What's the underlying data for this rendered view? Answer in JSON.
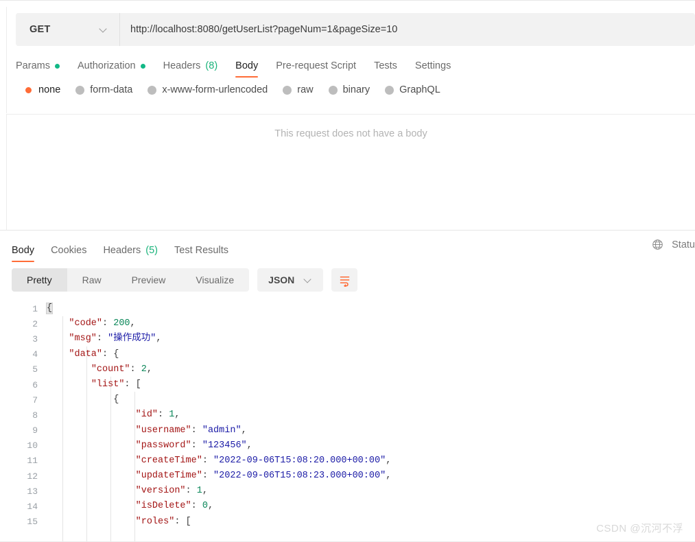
{
  "request": {
    "method": "GET",
    "url": "http://localhost:8080/getUserList?pageNum=1&pageSize=10",
    "tabs": [
      {
        "label": "Params",
        "marker": "dot",
        "active": false
      },
      {
        "label": "Authorization",
        "marker": "dot",
        "active": false
      },
      {
        "label": "Headers",
        "count": "(8)",
        "active": false
      },
      {
        "label": "Body",
        "active": true
      },
      {
        "label": "Pre-request Script",
        "active": false
      },
      {
        "label": "Tests",
        "active": false
      },
      {
        "label": "Settings",
        "active": false
      }
    ],
    "body_types": [
      {
        "label": "none",
        "selected": true
      },
      {
        "label": "form-data",
        "selected": false
      },
      {
        "label": "x-www-form-urlencoded",
        "selected": false
      },
      {
        "label": "raw",
        "selected": false
      },
      {
        "label": "binary",
        "selected": false
      },
      {
        "label": "GraphQL",
        "selected": false
      }
    ],
    "empty_body_message": "This request does not have a body"
  },
  "response": {
    "tabs": [
      {
        "label": "Body",
        "active": true
      },
      {
        "label": "Cookies",
        "active": false
      },
      {
        "label": "Headers",
        "count": "(5)",
        "active": false
      },
      {
        "label": "Test Results",
        "active": false
      }
    ],
    "status_text": "Statu",
    "view_modes": [
      {
        "label": "Pretty",
        "active": true
      },
      {
        "label": "Raw",
        "active": false
      },
      {
        "label": "Preview",
        "active": false
      },
      {
        "label": "Visualize",
        "active": false
      }
    ],
    "format": "JSON",
    "code_lines": [
      {
        "num": "1",
        "indent": 0,
        "tokens": [
          {
            "t": "{",
            "c": "p brk-hl"
          }
        ]
      },
      {
        "num": "2",
        "indent": 1,
        "tokens": [
          {
            "t": "\"code\"",
            "c": "k"
          },
          {
            "t": ": ",
            "c": "p"
          },
          {
            "t": "200",
            "c": "n"
          },
          {
            "t": ",",
            "c": "p"
          }
        ]
      },
      {
        "num": "3",
        "indent": 1,
        "tokens": [
          {
            "t": "\"msg\"",
            "c": "k"
          },
          {
            "t": ": ",
            "c": "p"
          },
          {
            "t": "\"操作成功\"",
            "c": "s"
          },
          {
            "t": ",",
            "c": "p"
          }
        ]
      },
      {
        "num": "4",
        "indent": 1,
        "tokens": [
          {
            "t": "\"data\"",
            "c": "k"
          },
          {
            "t": ": ",
            "c": "p"
          },
          {
            "t": "{",
            "c": "p"
          }
        ]
      },
      {
        "num": "5",
        "indent": 2,
        "tokens": [
          {
            "t": "\"count\"",
            "c": "k"
          },
          {
            "t": ": ",
            "c": "p"
          },
          {
            "t": "2",
            "c": "n"
          },
          {
            "t": ",",
            "c": "p"
          }
        ]
      },
      {
        "num": "6",
        "indent": 2,
        "tokens": [
          {
            "t": "\"list\"",
            "c": "k"
          },
          {
            "t": ": ",
            "c": "p"
          },
          {
            "t": "[",
            "c": "p"
          }
        ]
      },
      {
        "num": "7",
        "indent": 3,
        "tokens": [
          {
            "t": "{",
            "c": "p"
          }
        ]
      },
      {
        "num": "8",
        "indent": 4,
        "tokens": [
          {
            "t": "\"id\"",
            "c": "k"
          },
          {
            "t": ": ",
            "c": "p"
          },
          {
            "t": "1",
            "c": "n"
          },
          {
            "t": ",",
            "c": "p"
          }
        ]
      },
      {
        "num": "9",
        "indent": 4,
        "tokens": [
          {
            "t": "\"username\"",
            "c": "k"
          },
          {
            "t": ": ",
            "c": "p"
          },
          {
            "t": "\"admin\"",
            "c": "s"
          },
          {
            "t": ",",
            "c": "p"
          }
        ]
      },
      {
        "num": "10",
        "indent": 4,
        "tokens": [
          {
            "t": "\"password\"",
            "c": "k"
          },
          {
            "t": ": ",
            "c": "p"
          },
          {
            "t": "\"123456\"",
            "c": "s"
          },
          {
            "t": ",",
            "c": "p"
          }
        ]
      },
      {
        "num": "11",
        "indent": 4,
        "tokens": [
          {
            "t": "\"createTime\"",
            "c": "k"
          },
          {
            "t": ": ",
            "c": "p"
          },
          {
            "t": "\"2022-09-06T15:08:20.000+00:00\"",
            "c": "s"
          },
          {
            "t": ",",
            "c": "p"
          }
        ]
      },
      {
        "num": "12",
        "indent": 4,
        "tokens": [
          {
            "t": "\"updateTime\"",
            "c": "k"
          },
          {
            "t": ": ",
            "c": "p"
          },
          {
            "t": "\"2022-09-06T15:08:23.000+00:00\"",
            "c": "s"
          },
          {
            "t": ",",
            "c": "p"
          }
        ]
      },
      {
        "num": "13",
        "indent": 4,
        "tokens": [
          {
            "t": "\"version\"",
            "c": "k"
          },
          {
            "t": ": ",
            "c": "p"
          },
          {
            "t": "1",
            "c": "n"
          },
          {
            "t": ",",
            "c": "p"
          }
        ]
      },
      {
        "num": "14",
        "indent": 4,
        "tokens": [
          {
            "t": "\"isDelete\"",
            "c": "k"
          },
          {
            "t": ": ",
            "c": "p"
          },
          {
            "t": "0",
            "c": "n"
          },
          {
            "t": ",",
            "c": "p"
          }
        ]
      },
      {
        "num": "15",
        "indent": 4,
        "tokens": [
          {
            "t": "\"roles\"",
            "c": "k"
          },
          {
            "t": ": ",
            "c": "p"
          },
          {
            "t": "[",
            "c": "p"
          }
        ]
      }
    ]
  },
  "watermark": "CSDN @沉河不浮",
  "colors": {
    "accent": "#ff6c37",
    "dot_green": "#12b886",
    "key": "#a31515",
    "string": "#1a1aa6",
    "number": "#098658"
  }
}
